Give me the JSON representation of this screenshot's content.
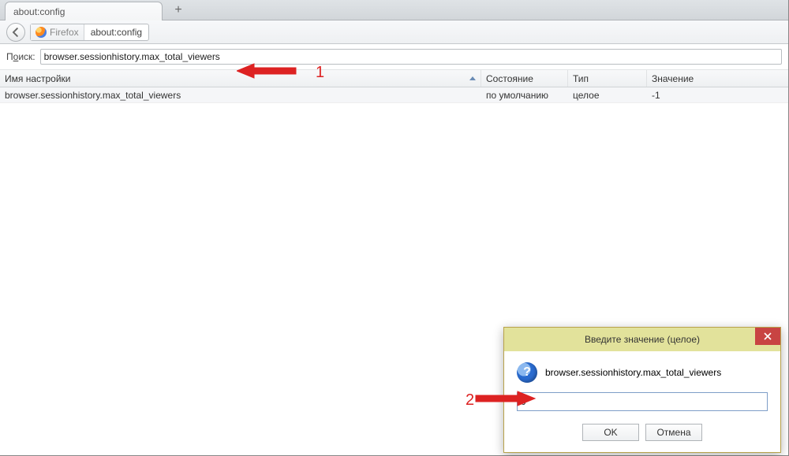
{
  "tab": {
    "title": "about:config"
  },
  "toolbar": {
    "brand": "Firefox",
    "address": "about:config"
  },
  "search": {
    "label_prefix": "П",
    "label_underline": "о",
    "label_suffix": "иск:",
    "value": "browser.sessionhistory.max_total_viewers"
  },
  "columns": {
    "name": "Имя настройки",
    "state": "Состояние",
    "type": "Тип",
    "value": "Значение"
  },
  "rows": [
    {
      "name": "browser.sessionhistory.max_total_viewers",
      "state": "по умолчанию",
      "type": "целое",
      "value": "-1"
    }
  ],
  "dialog": {
    "title": "Введите значение (целое)",
    "label": "browser.sessionhistory.max_total_viewers",
    "value": "0",
    "ok": "OK",
    "cancel": "Отмена"
  },
  "annotations": {
    "one": "1",
    "two": "2"
  }
}
